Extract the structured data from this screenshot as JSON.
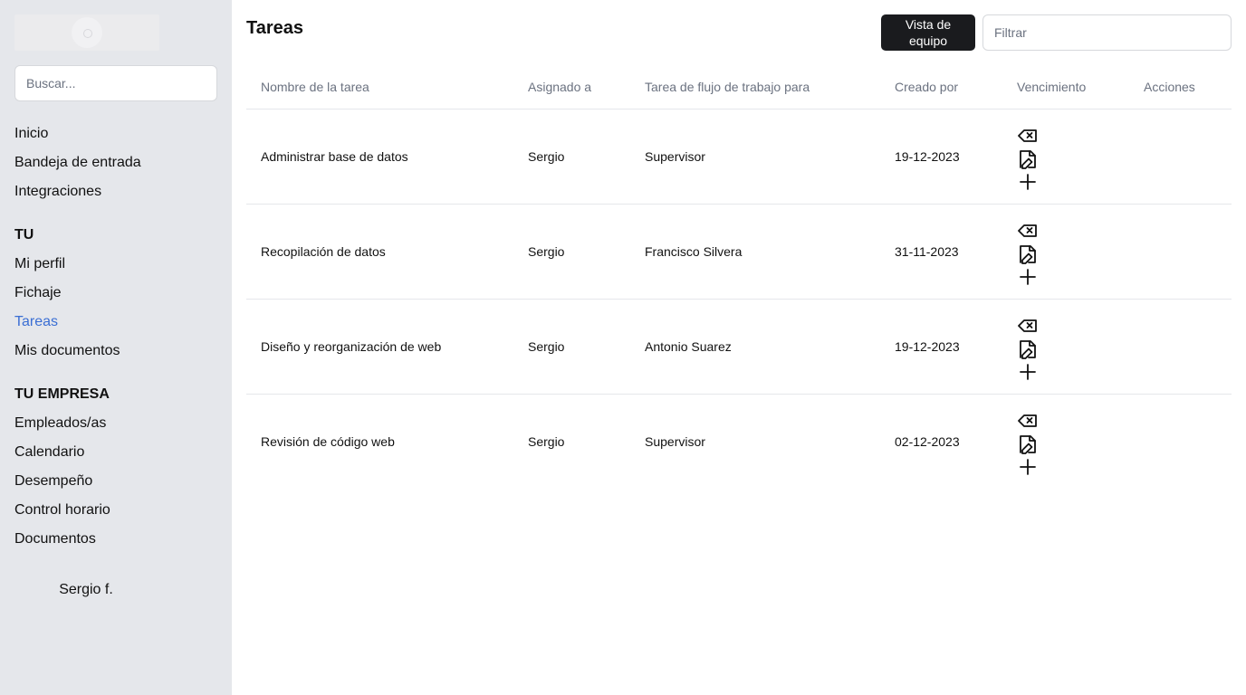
{
  "sidebar": {
    "search_placeholder": "Buscar...",
    "nav_main": [
      "Inicio",
      "Bandeja de entrada",
      "Integraciones"
    ],
    "section_you": "TU",
    "nav_you": [
      "Mi perfil",
      "Fichaje",
      "Tareas",
      "Mis documentos"
    ],
    "section_company": "TU EMPRESA",
    "nav_company": [
      "Empleados/as",
      "Calendario",
      "Desempeño",
      "Control horario",
      "Documentos"
    ],
    "active_item": "Tareas",
    "user_name": "Sergio f."
  },
  "header": {
    "title": "Tareas",
    "team_view_label": "Vista de equipo",
    "filter_placeholder": "Filtrar"
  },
  "table": {
    "columns": [
      "Nombre de la tarea",
      "Asignado a",
      "Tarea de flujo de trabajo para",
      "Creado por",
      "Vencimiento",
      "Acciones"
    ],
    "rows": [
      {
        "name": "Administrar base de datos",
        "assigned": "Sergio",
        "workflow_for": "Supervisor",
        "date": "19-12-2023"
      },
      {
        "name": "Recopilación de datos",
        "assigned": "Sergio",
        "workflow_for": "Francisco Silvera",
        "date": "31-11-2023"
      },
      {
        "name": "Diseño y reorganización de web",
        "assigned": "Sergio",
        "workflow_for": "Antonio Suarez",
        "date": "19-12-2023"
      },
      {
        "name": "Revisión de código web",
        "assigned": "Sergio",
        "workflow_for": "Supervisor",
        "date": "02-12-2023"
      }
    ],
    "row_action_icons": [
      "backspace-delete-icon",
      "file-edit-icon",
      "plus-icon"
    ]
  },
  "colors": {
    "sidebar_bg": "#e5e7eb",
    "active_link": "#3b6fd4",
    "primary_button": "#1a1b1e",
    "header_text": "#6b7280",
    "divider": "#e5e7eb"
  }
}
